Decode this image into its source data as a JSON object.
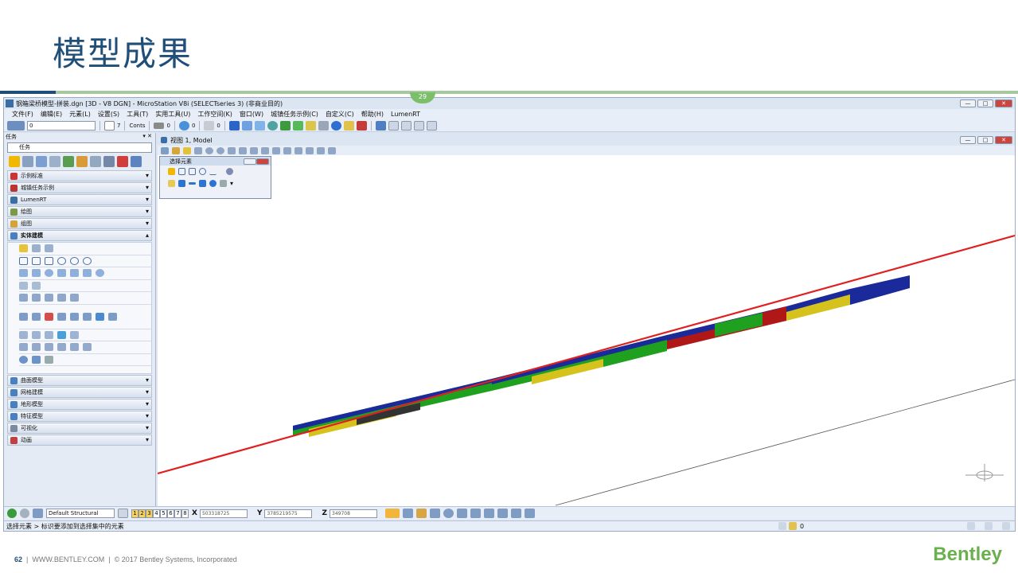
{
  "slide": {
    "title": "模型成果",
    "badge": "29",
    "page_number": "62",
    "footer_url": "WWW.BENTLEY.COM",
    "footer_copyright": "© 2017 Bentley Systems, Incorporated",
    "brand": "Bentley"
  },
  "window": {
    "title": "钢箱梁桥模型-拼装.dgn [3D - V8 DGN] - MicroStation V8i (SELECTseries 3) (非商业目的)",
    "menu": [
      "文件(F)",
      "编辑(E)",
      "元素(L)",
      "设置(S)",
      "工具(T)",
      "实用工具(U)",
      "工作空间(K)",
      "窗口(W)",
      "城镇任务示例(C)",
      "自定义(C)",
      "帮助(H)",
      "LumenRT"
    ],
    "level_value": "0",
    "color_value": "7",
    "line_style": "Conts",
    "weight_value": "0",
    "transp_value": "0",
    "priority_value": "0"
  },
  "left_panel": {
    "header": "任务",
    "task_select": "任务",
    "categories_top": [
      "示例标准",
      "城镇任务示例",
      "LumenRT",
      "绘图",
      "组图"
    ],
    "open_category": "实体建模",
    "categories_bottom": [
      "曲面模型",
      "网格建模",
      "地形模型",
      "特征模型",
      "可视化",
      "动画"
    ]
  },
  "view": {
    "title": "视图 1, Model",
    "floating_title": "选择元素"
  },
  "status": {
    "view_buttons": [
      "1",
      "2",
      "3",
      "4",
      "5",
      "6",
      "7",
      "8"
    ],
    "active_views": [
      "1",
      "2",
      "3"
    ],
    "element_template": "Default Structural",
    "x_label": "X",
    "x_value": "503318725",
    "y_label": "Y",
    "y_value": "3785219575",
    "z_label": "Z",
    "z_value": "349708",
    "prompt": "选择元素 > 标识要添加到选择集中的元素",
    "right_value": "0"
  },
  "colors": {
    "title_blue": "#1f4e79",
    "brand_green": "#6ab04c",
    "alignment_red": "#e02020",
    "bridge_green": "#1fa01f",
    "bridge_yellow": "#d6c21c",
    "bridge_red": "#b01818",
    "bridge_blue": "#1a2a9a"
  }
}
